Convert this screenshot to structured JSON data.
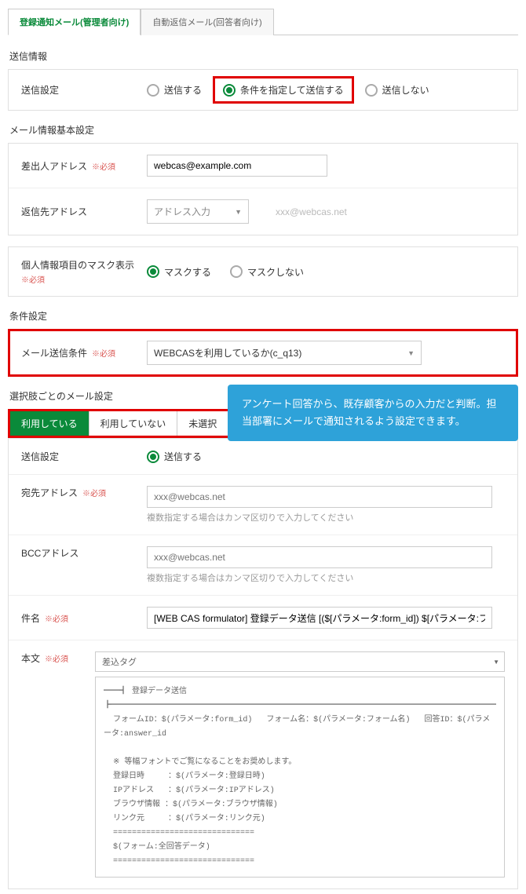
{
  "tabs": {
    "active": "登録通知メール(管理者向け)",
    "inactive": "自動返信メール(回答者向け)"
  },
  "section_send_info": "送信情報",
  "send_setting": {
    "label": "送信設定",
    "opt_send": "送信する",
    "opt_cond": "条件を指定して送信する",
    "opt_none": "送信しない"
  },
  "section_mail_basic": "メール情報基本設定",
  "sender": {
    "label": "差出人アドレス",
    "required": "※必須",
    "value": "webcas@example.com"
  },
  "reply": {
    "label": "返信先アドレス",
    "select": "アドレス入力",
    "placeholder": "xxx@webcas.net"
  },
  "mask": {
    "label": "個人情報項目のマスク表示",
    "required": "※必須",
    "opt_yes": "マスクする",
    "opt_no": "マスクしない"
  },
  "section_cond": "条件設定",
  "cond": {
    "label": "メール送信条件",
    "required": "※必須",
    "value": "WEBCASを利用しているか(c_q13)"
  },
  "section_choice": "選択肢ごとのメール設定",
  "sub_tabs": {
    "a": "利用している",
    "b": "利用していない",
    "c": "未選択"
  },
  "callout": "アンケート回答から、既存顧客からの入力だと判断。担当部署にメールで通知されるよう設定できます。",
  "send2": {
    "label": "送信設定",
    "opt": "送信する"
  },
  "to": {
    "label": "宛先アドレス",
    "required": "※必須",
    "placeholder": "xxx@webcas.net",
    "help": "複数指定する場合はカンマ区切りで入力してください"
  },
  "bcc": {
    "label": "BCCアドレス",
    "placeholder": "xxx@webcas.net",
    "help": "複数指定する場合はカンマ区切りで入力してください"
  },
  "subject": {
    "label": "件名",
    "required": "※必須",
    "value": "[WEB CAS formulator] 登録データ送信 [($[パラメータ:form_id]) $[パラメータ:フォーム名]:$[パラメータ:answer_id]]"
  },
  "body": {
    "label": "本文",
    "required": "※必須",
    "insert": "差込タグ",
    "content": "━━┫ 登録データ送信 ┣━━━━━━━━━━━━━━━━━━━━━━━━━━━━━━━━━━━━━━━━━━━━━━━━━\n  フォームID：$(パラメータ:form_id)   フォーム名：$(パラメータ:フォーム名)   回答ID：$(パラメータ:answer_id\n\n  ※ 等幅フォントでご覧になることをお奨めします。\n  登録日時     ：$(パラメータ:登録日時)\n  IPアドレス   ：$(パラメータ:IPアドレス)\n  ブラウザ情報 ：$(パラメータ:ブラウザ情報)\n  リンク元     ：$(パラメータ:リンク元)\n  ==============================\n  $(フォーム:全回答データ)\n  =============================="
  }
}
